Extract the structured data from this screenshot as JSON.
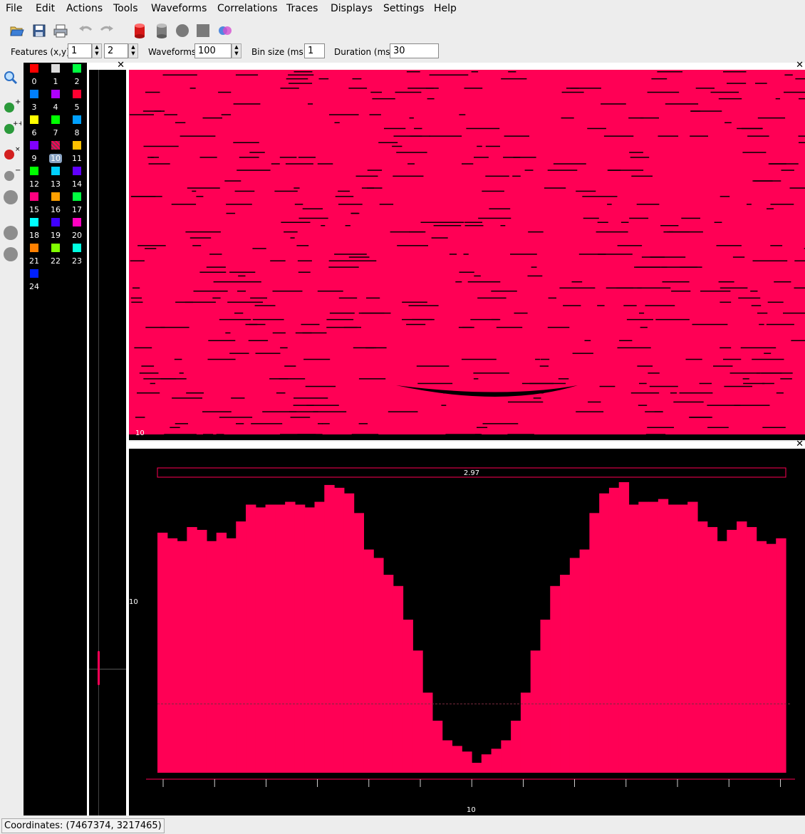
{
  "menus": [
    "File",
    "Edit",
    "Actions",
    "Tools",
    "Waveforms",
    "Correlations",
    "Traces",
    "Displays",
    "Settings",
    "Help"
  ],
  "toolbar_icons": [
    "open-icon",
    "save-icon",
    "print-icon",
    "undo-icon",
    "redo-icon",
    "red-cylinder-icon",
    "gray-cylinder-icon",
    "gray-circle-icon",
    "gray-square-icon",
    "venn-icon"
  ],
  "params": {
    "features_label": "Features (x,y)",
    "feature_x": "1",
    "feature_y": "2",
    "waveforms_label": "Waveforms",
    "waveforms": "100",
    "binsize_label": "Bin size (ms)",
    "binsize": "1",
    "duration_label": "Duration (ms)",
    "duration": "30"
  },
  "left_tools": [
    "zoom-icon",
    "add-cluster-icon",
    "add-multi-cluster-icon",
    "delete-cluster-icon",
    "remove-cluster-icon",
    "gray-circle-icon",
    "gray-circle-icon",
    "gray-circle-icon"
  ],
  "clusters": [
    {
      "label": "0",
      "color": "#ff0000"
    },
    {
      "label": "1",
      "color": "#dcdcdc"
    },
    {
      "label": "2",
      "color": "#00ff40"
    },
    {
      "label": "3",
      "color": "#0080ff"
    },
    {
      "label": "4",
      "color": "#b000ff"
    },
    {
      "label": "5",
      "color": "#ff0030"
    },
    {
      "label": "6",
      "color": "#ffff00"
    },
    {
      "label": "7",
      "color": "#00ff00"
    },
    {
      "label": "8",
      "color": "#00a0ff"
    },
    {
      "label": "9",
      "color": "#8000ff"
    },
    {
      "label": "10",
      "color": "#ff0055"
    },
    {
      "label": "11",
      "color": "#ffc000"
    },
    {
      "label": "12",
      "color": "#00ff00"
    },
    {
      "label": "13",
      "color": "#00d0ff"
    },
    {
      "label": "14",
      "color": "#6000ff"
    },
    {
      "label": "15",
      "color": "#ff0080"
    },
    {
      "label": "16",
      "color": "#ffa000"
    },
    {
      "label": "17",
      "color": "#00ff40"
    },
    {
      "label": "18",
      "color": "#00ffff"
    },
    {
      "label": "19",
      "color": "#4000ff"
    },
    {
      "label": "20",
      "color": "#ff00c0"
    },
    {
      "label": "21",
      "color": "#ff8000"
    },
    {
      "label": "22",
      "color": "#80ff00"
    },
    {
      "label": "23",
      "color": "#00ffe0"
    },
    {
      "label": "24",
      "color": "#0020ff"
    }
  ],
  "selected_cluster": "10",
  "raster": {
    "cluster_label": "10",
    "color": "#ff0055"
  },
  "histogram": {
    "top_label": "2.97",
    "y_label": "10",
    "x_label": "10",
    "color": "#ff0055"
  },
  "chart_data": {
    "type": "bar",
    "title": "2.97",
    "xlabel": "10",
    "ylabel": "10",
    "values": [
      0.82,
      0.8,
      0.79,
      0.84,
      0.83,
      0.79,
      0.82,
      0.8,
      0.86,
      0.92,
      0.91,
      0.92,
      0.92,
      0.93,
      0.92,
      0.91,
      0.93,
      0.99,
      0.98,
      0.96,
      0.89,
      0.76,
      0.73,
      0.67,
      0.63,
      0.51,
      0.4,
      0.25,
      0.15,
      0.08,
      0.06,
      0.04,
      0.0,
      0.03,
      0.05,
      0.08,
      0.15,
      0.25,
      0.4,
      0.51,
      0.63,
      0.67,
      0.73,
      0.76,
      0.89,
      0.96,
      0.98,
      1.0,
      0.92,
      0.93,
      0.93,
      0.94,
      0.92,
      0.92,
      0.93,
      0.86,
      0.84,
      0.79,
      0.83,
      0.86,
      0.84,
      0.79,
      0.78,
      0.8
    ],
    "ref_line": 0.21
  },
  "status": {
    "coordinates": "Coordinates: (7467374, 3217465)"
  }
}
